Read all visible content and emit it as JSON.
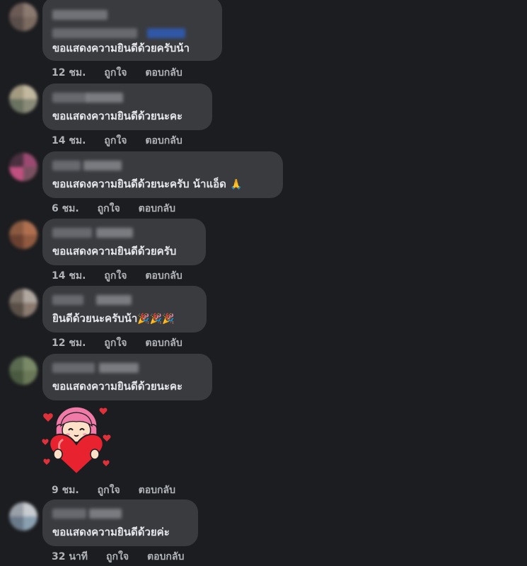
{
  "comments": [
    {
      "text": "ขอแสดงความยินดีด้วยครับน้า",
      "time": "12 ชม.",
      "like": "ถูกใจ",
      "reply": "ตอบกลับ"
    },
    {
      "text": "ขอแสดงความยินดีด้วยนะคะ",
      "time": "14 ชม.",
      "like": "ถูกใจ",
      "reply": "ตอบกลับ"
    },
    {
      "text": "ขอแสดงความยินดีด้วยนะครับ น้าแอ็ด",
      "emoji": "🙏",
      "time": "6 ชม.",
      "like": "ถูกใจ",
      "reply": "ตอบกลับ"
    },
    {
      "text": "ขอแสดงความยินดีด้วยครับ",
      "time": "14 ชม.",
      "like": "ถูกใจ",
      "reply": "ตอบกลับ"
    },
    {
      "text": "ยินดีด้วยนะครับน้า",
      "emoji": "🎉🎉🎉",
      "time": "12 ชม.",
      "like": "ถูกใจ",
      "reply": "ตอบกลับ"
    },
    {
      "text": "ขอแสดงความยินดีด้วยนะคะ",
      "time": "9 ชม.",
      "like": "ถูกใจ",
      "reply": "ตอบกลับ"
    },
    {
      "text": "ขอแสดงความยินดีด้วยค่ะ",
      "time": "32 นาที",
      "like": "ถูกใจ",
      "reply": "ตอบกลับ"
    }
  ],
  "colors": {
    "background": "#1c1d20",
    "bubble": "#3a3b3f",
    "meta_text": "#b0b3b8",
    "comment_text": "#e4e6eb"
  },
  "sticker": {
    "icon": "girl-hugging-heart-sticker"
  }
}
